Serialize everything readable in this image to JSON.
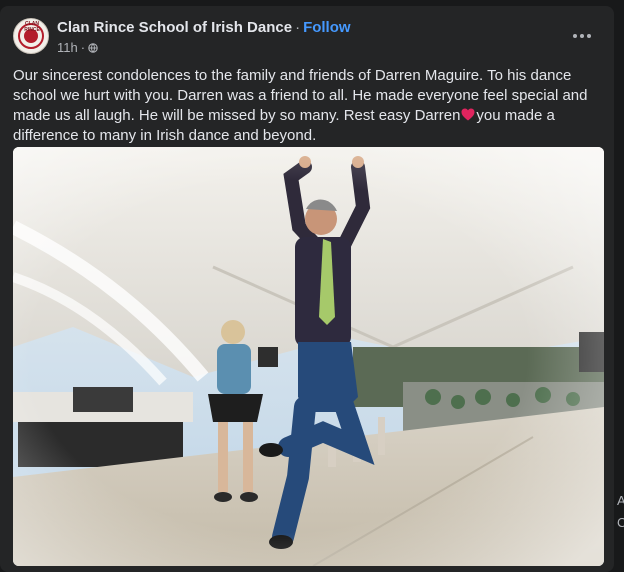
{
  "post": {
    "page_name": "Clan Rince School of Irish Dance",
    "separator": "·",
    "follow_label": "Follow",
    "timestamp": "11h",
    "meta_separator": "·",
    "privacy_icon": "globe-icon",
    "avatar_text": "CLAN RINCE",
    "text_part1": "Our sincerest condolences to the family and friends of Darren Maguire.  To his dance school we hurt with you.  Darren was a friend to all.  He made everyone feel special and made us all laugh.  He will be missed by so many. Rest easy Darren",
    "text_part2": "you made a difference to many in Irish dance and beyond.",
    "heart_color": "#e0245e"
  },
  "side_fragment": [
    "A",
    "C"
  ],
  "colors": {
    "background": "#18191a",
    "card": "#242526",
    "text": "#e4e6eb",
    "muted": "#b0b3b8",
    "link": "#4599ff"
  }
}
